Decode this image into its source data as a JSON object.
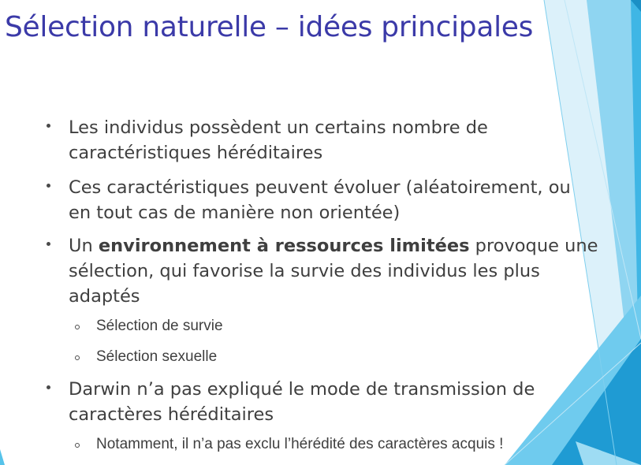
{
  "slide": {
    "title": "Sélection naturelle – idées principales",
    "bullets": [
      {
        "lines": [
          "Les individus possèdent un certains nombre de",
          "caractéristiques héréditaires"
        ]
      },
      {
        "lines": [
          "Ces caractéristiques peuvent évoluer (aléatoirement, ou",
          "en tout cas de manière non orientée)"
        ]
      },
      {
        "line1_before": "Un ",
        "line1_bold": "environnement à ressources limitées",
        "line1_after": " provoque une",
        "line2": "sélection, qui favorise la survie des individus les plus",
        "line3": "adaptés"
      },
      {
        "text": "Sélection de survie"
      },
      {
        "text": "Sélection sexuelle"
      },
      {
        "lines": [
          "Darwin n’a pas expliqué le mode de transmission de",
          "caractères héréditaires"
        ]
      },
      {
        "text": "Notamment, il n’a pas exclu l’hérédité des caractères acquis !"
      }
    ]
  },
  "colors": {
    "title": "#3b3aa8",
    "body_text": "#3f3f3f",
    "accent_light": "#bde6f6",
    "accent_mid": "#56c3ea",
    "accent_dark": "#1f9bd3"
  }
}
